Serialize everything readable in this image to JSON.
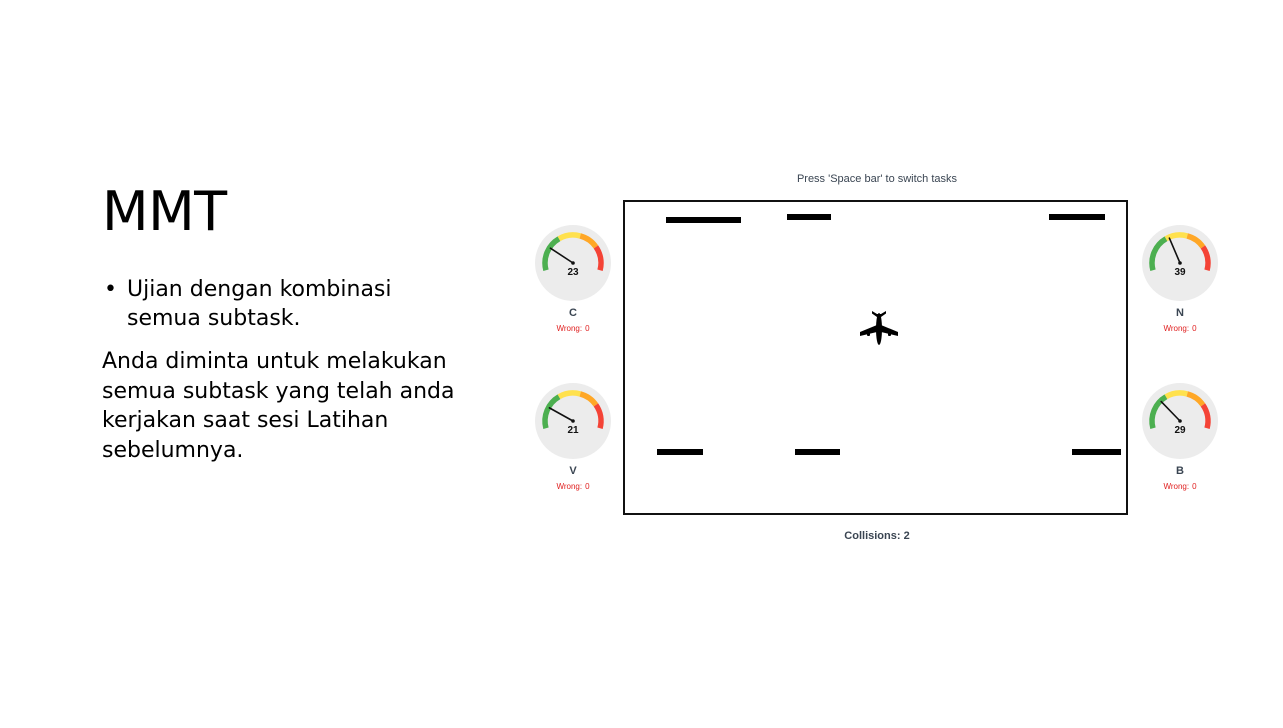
{
  "slide": {
    "title": "MMT",
    "bullet": "Ujian dengan kombinasi semua subtask.",
    "paragraph": "Anda diminta untuk melakukan semua subtask yang telah anda kerjakan saat sesi Latihan sebelumnya."
  },
  "task": {
    "hint": "Press 'Space bar' to switch tasks",
    "collisions_label": "Collisions: 2",
    "icon": "airplane-icon"
  },
  "gauges": [
    {
      "key": "C",
      "value": "23",
      "level": 0.23,
      "wrong_label": "Wrong:",
      "wrong_count": "0"
    },
    {
      "key": "N",
      "value": "39",
      "level": 0.39,
      "wrong_label": "Wrong:",
      "wrong_count": "0"
    },
    {
      "key": "V",
      "value": "21",
      "level": 0.21,
      "wrong_label": "Wrong:",
      "wrong_count": "0"
    },
    {
      "key": "B",
      "value": "29",
      "level": 0.29,
      "wrong_label": "Wrong:",
      "wrong_count": "0"
    }
  ],
  "colors": {
    "gauge_green": "#4caf50",
    "gauge_yellow": "#ffe14d",
    "gauge_orange": "#ffa726",
    "gauge_red": "#f44336",
    "gauge_face": "#ececec",
    "wrong_text": "#e02020"
  }
}
